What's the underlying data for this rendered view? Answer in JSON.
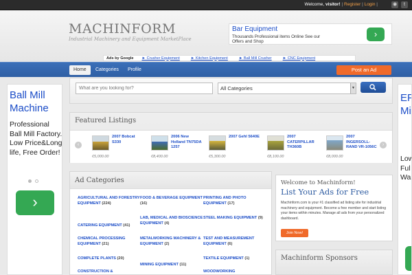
{
  "topbar": {
    "welcome": "Welcome,",
    "user": "visitor!",
    "register": "Register",
    "login": "Login",
    "sep": "|",
    "icons": [
      "rss-icon",
      "twitter-icon"
    ]
  },
  "header": {
    "logo": "MACHINFORM",
    "tagline": "Industrial Machinery and Equipment MarketPlace"
  },
  "top_ad": {
    "title": "Bar Equipment",
    "text": "Thousands Professional items Online See our Offers and Shop"
  },
  "ad_links": {
    "label": "Ads by Google",
    "links": [
      "► Crusher Equipment",
      "► Kitchen Equipment",
      "► Ball Mill Crusher",
      "► CNC Equipment"
    ]
  },
  "nav": {
    "tabs": [
      "Home",
      "Categories",
      "Profile"
    ],
    "post_ad": "Post an Ad"
  },
  "left_ad": {
    "title": "Ball Mill Machine",
    "text": "Professional Ball Mill Factory. Low Price&Long life, Free Order!"
  },
  "right_ad": {
    "title": "EPI Tub Mi Pip",
    "text": "Low and Qu Ful Ser and Wa"
  },
  "search": {
    "placeholder": "What are you looking for?",
    "category": "All Categories"
  },
  "featured": {
    "title": "Featured Listings",
    "items": [
      {
        "name": "2007 Bobcat S330",
        "price": "€5,000.00",
        "color": "#c9a23a"
      },
      {
        "name": "2006 New Holland TN75DA 1257",
        "price": "€8,400.00",
        "color": "#3f6db3"
      },
      {
        "name": "2007 Gehl 5640E",
        "price": "€5,300.00",
        "color": "#d3b43c"
      },
      {
        "name": "2007 CATERPILLAR TH360B",
        "price": "€8,100.00",
        "color": "#a8a23c"
      },
      {
        "name": "2007 INGERSOLL-RAND VR-1056C",
        "price": "€8,000.00",
        "color": "#7fa7c9"
      }
    ]
  },
  "categories": {
    "title": "Ad Categories",
    "items": [
      {
        "name": "AGRICULTURAL AND FORESTRY EQUIPMENT",
        "count": "(224)"
      },
      {
        "name": "FOOD & BEVERAGE EQUIPMENT",
        "count": "(16)"
      },
      {
        "name": "PRINTING AND PHOTO EQUIPMENT",
        "count": "(17)"
      },
      {
        "name": "CATERING EQUIPMENT",
        "count": "(41)"
      },
      {
        "name": "LAB, MEDICAL AND BIOSCIENCE EQUIPMENT",
        "count": "(4)"
      },
      {
        "name": "STEEL MAKING EQUIPMENT",
        "count": "(9)"
      },
      {
        "name": "CHEMICAL PROCESSING EQUIPMENT",
        "count": "(21)"
      },
      {
        "name": "METALWORKING MACHINERY & EQUIPMENT",
        "count": "(2)"
      },
      {
        "name": "TEST AND MEASUREMENT EQUIPMENT",
        "count": "(6)"
      },
      {
        "name": "COMPLETE PLANTS",
        "count": "(20)"
      },
      {
        "name": "MINING EQUIPMENT",
        "count": "(11)"
      },
      {
        "name": "TEXTILE EQUIPMENT",
        "count": "(1)"
      },
      {
        "name": "CONSTRUCTION &",
        "count": ""
      },
      {
        "name": "",
        "count": ""
      },
      {
        "name": "WOODWORKING",
        "count": ""
      }
    ]
  },
  "welcome_box": {
    "greeting": "Welcome to Machinform!",
    "headline": "List Your Ads for Free",
    "text": "Machinform.com is your #1 classified ad listing site for industrial machinery and equipment. Become a free member and start listing your items within minutes. Manage all ads from your personalized dashboard.",
    "join": "Join Now!"
  },
  "sponsors": {
    "title": "Machinform Sponsors"
  }
}
